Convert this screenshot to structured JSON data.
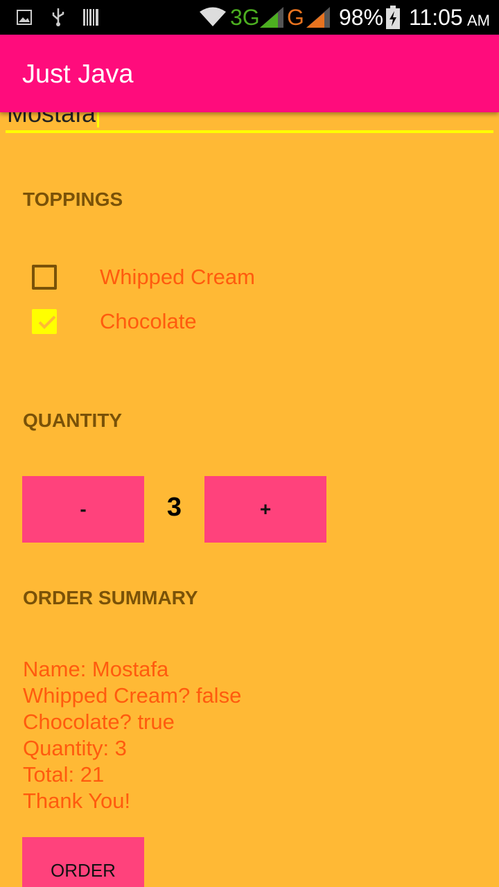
{
  "status_bar": {
    "network_1": "3G",
    "network_2": "G",
    "battery": "98%",
    "time": "11:05",
    "ampm": "AM",
    "icons": [
      "image-icon",
      "usb-icon",
      "barcode-icon",
      "wifi-icon",
      "signal-icon",
      "signal-icon",
      "battery-icon"
    ]
  },
  "app_bar": {
    "title": "Just Java"
  },
  "name_field": {
    "value": "Mostafa"
  },
  "toppings": {
    "header": "TOPPINGS",
    "items": [
      {
        "label": "Whipped Cream",
        "checked": false
      },
      {
        "label": "Chocolate",
        "checked": true
      }
    ]
  },
  "quantity": {
    "header": "QUANTITY",
    "decrement_label": "-",
    "value": "3",
    "increment_label": "+"
  },
  "order_summary": {
    "header": "ORDER SUMMARY",
    "lines": [
      "Name: Mostafa",
      "Whipped Cream? false",
      "Chocolate? true",
      "Quantity: 3",
      "Total: 21",
      "Thank You!"
    ]
  },
  "order_button": {
    "label": "ORDER"
  },
  "colors": {
    "background": "#FFB935",
    "app_bar": "#FF0C7C",
    "button": "#FF427C",
    "accent": "#FFFF00",
    "header_text": "#7A5208",
    "body_text": "#FF5B0E"
  }
}
